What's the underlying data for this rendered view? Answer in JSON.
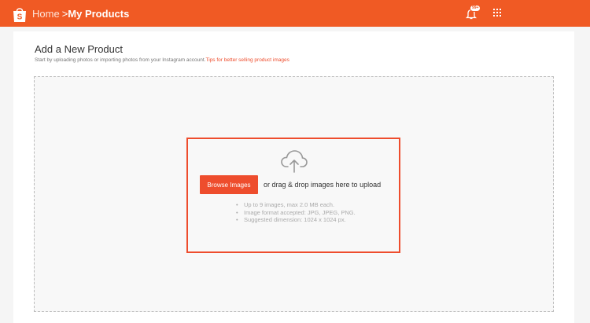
{
  "header": {
    "logo_icon": "shopee-bag-icon",
    "breadcrumb": {
      "home": "Home",
      "separator": ">",
      "current": "My Products"
    },
    "notification": {
      "icon": "bell-icon",
      "badge": "99+"
    },
    "apps_icon": "grid-icon"
  },
  "main": {
    "title": "Add a New Product",
    "subtitle": "Start by uploading photos or importing photos from your Instagram account.",
    "tips_link": "Tips for better selling product images"
  },
  "upload": {
    "icon": "cloud-upload-icon",
    "browse_button": "Browse Images",
    "drag_text": "or drag & drop images here to upload",
    "rules": [
      "Up to 9 images, max 2.0 MB each.",
      "Image format accepted: JPG, JPEG, PNG.",
      "Suggested dimension: 1024 x 1024 px."
    ]
  },
  "colors": {
    "brand": "#f05a24",
    "accent": "#ee4d2d"
  }
}
